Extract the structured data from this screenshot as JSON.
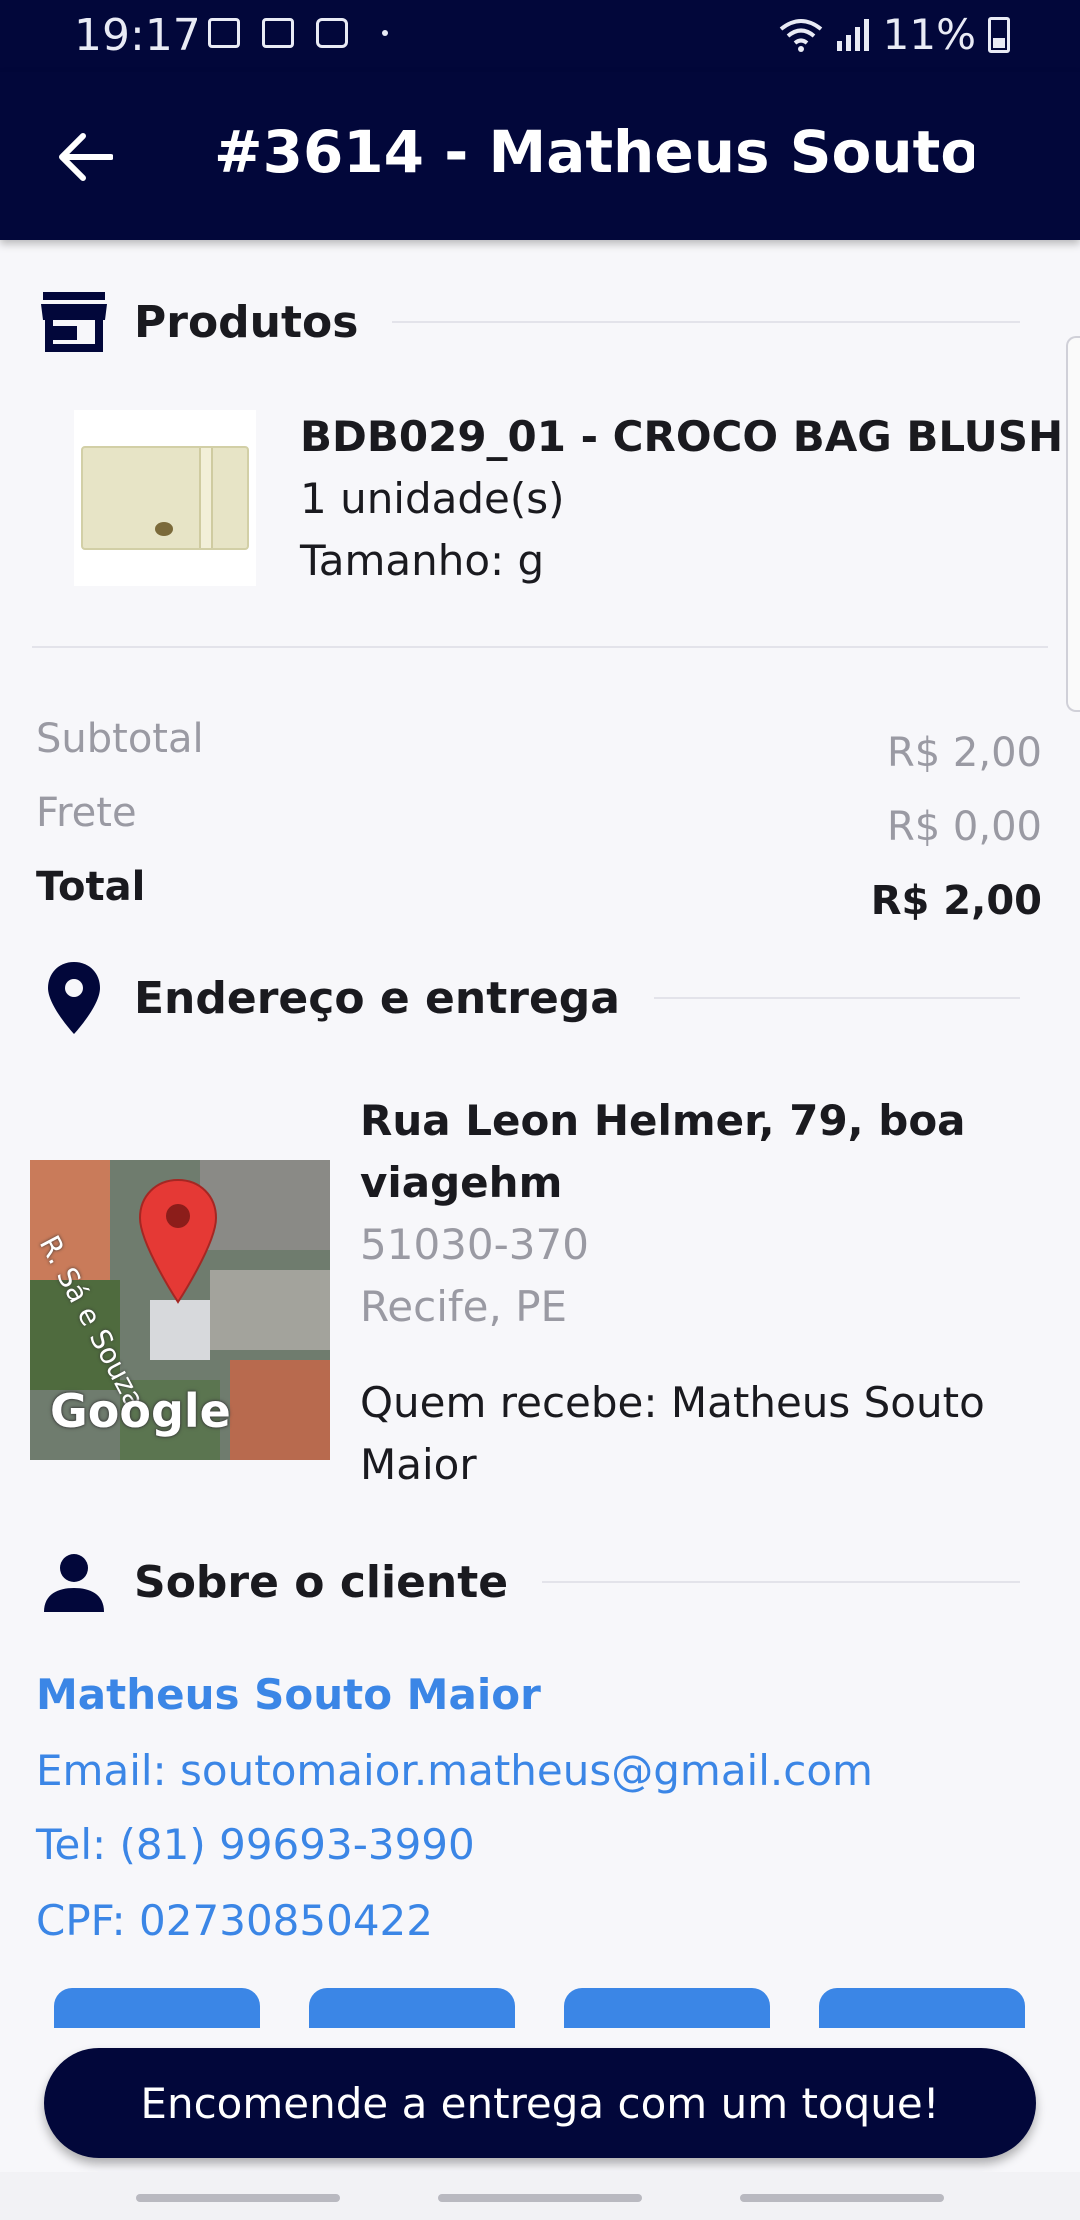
{
  "status_bar": {
    "time": "19:17",
    "battery": "11%",
    "icons": [
      "mail-icon",
      "image-icon",
      "clock-icon",
      "dot-icon",
      "wifi-icon",
      "signal-icon",
      "battery-icon"
    ]
  },
  "app_bar": {
    "title": "#3614 - Matheus Souto ...",
    "back_icon": "arrow-left-icon"
  },
  "products": {
    "section_title": "Produtos",
    "icon": "store-icon",
    "items": [
      {
        "name": "BDB029_01 - CROCO BAG BLUSH",
        "quantity": "1 unidade(s)",
        "size": "Tamanho: g"
      }
    ]
  },
  "summary": {
    "subtotal_label": "Subtotal",
    "subtotal_value": "R$ 2,00",
    "shipping_label": "Frete",
    "shipping_value": "R$ 0,00",
    "total_label": "Total",
    "total_value": "R$ 2,00"
  },
  "delivery": {
    "section_title": "Endereço e entrega",
    "icon": "location-pin-icon",
    "street": "Rua Leon Helmer, 79, boa viagehm",
    "zip": "51030-370",
    "city": "Recife, PE",
    "receiver": "Quem recebe: Matheus Souto Maior",
    "map": {
      "street_label": "R. Sá e Souza",
      "brand": "Google"
    }
  },
  "client": {
    "section_title": "Sobre o cliente",
    "icon": "person-icon",
    "name": "Matheus Souto Maior",
    "email": "Email: soutomaior.matheus@gmail.com",
    "phone": "Tel: (81) 99693-3990",
    "cpf": "CPF: 02730850422"
  },
  "cta": {
    "label": "Encomende a entrega com um toque!"
  },
  "colors": {
    "primary": "#02073a",
    "link": "#3b86e6",
    "muted": "#9a9aa3",
    "map_pin": "#e53935"
  }
}
